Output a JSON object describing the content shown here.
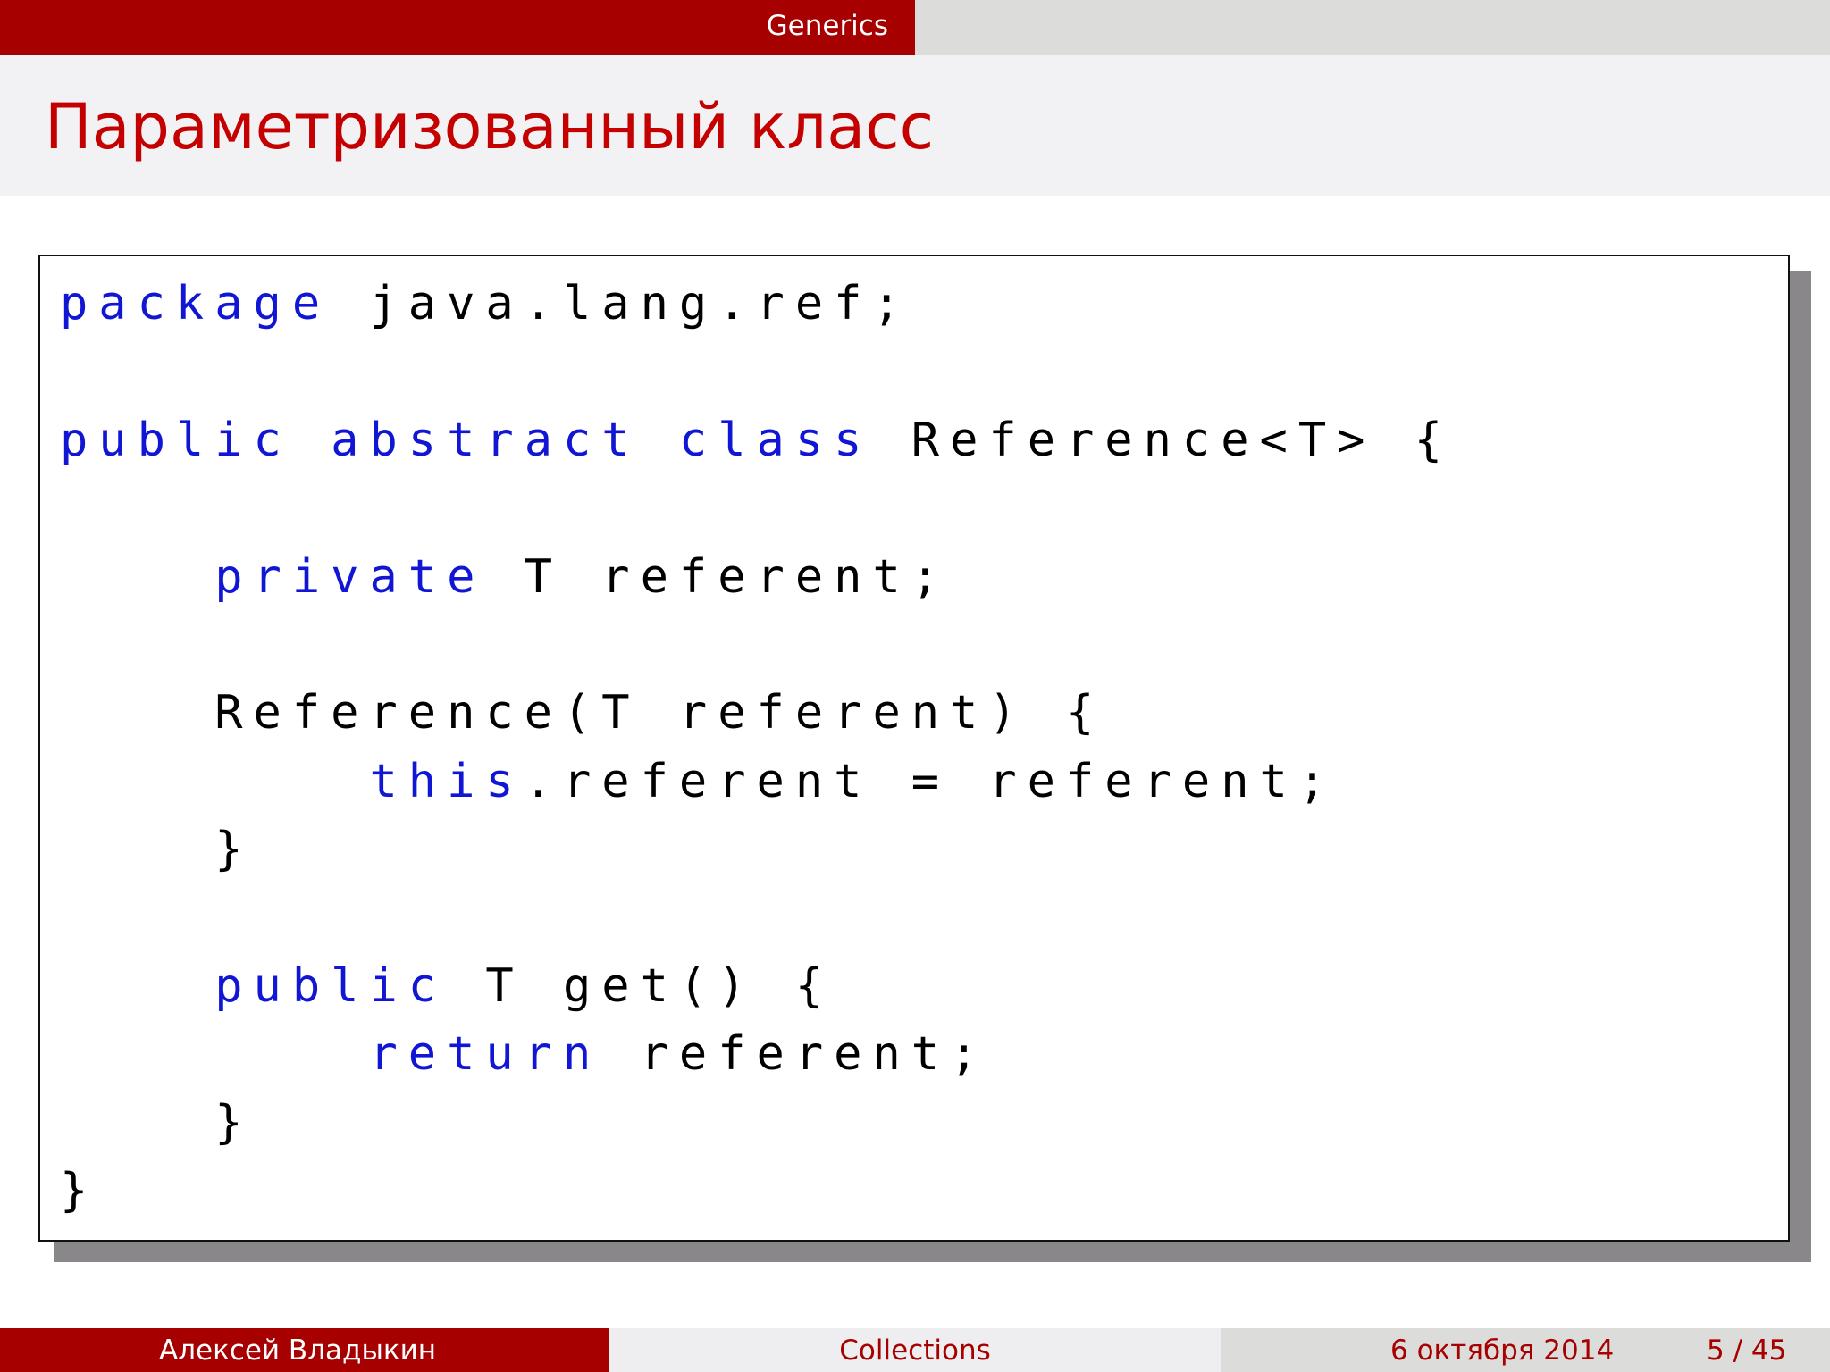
{
  "header": {
    "section": "Generics"
  },
  "frame": {
    "title": "Параметризованный класс"
  },
  "code": {
    "lines": [
      [
        {
          "t": "package",
          "kw": true
        },
        {
          "t": " java.lang.ref;"
        }
      ],
      [],
      [
        {
          "t": "public",
          "kw": true
        },
        {
          "t": " "
        },
        {
          "t": "abstract",
          "kw": true
        },
        {
          "t": " "
        },
        {
          "t": "class",
          "kw": true
        },
        {
          "t": " Reference<T> {"
        }
      ],
      [],
      [
        {
          "t": "    "
        },
        {
          "t": "private",
          "kw": true
        },
        {
          "t": " T referent;"
        }
      ],
      [],
      [
        {
          "t": "    Reference(T referent) {"
        }
      ],
      [
        {
          "t": "        "
        },
        {
          "t": "this",
          "kw": true
        },
        {
          "t": ".referent = referent;"
        }
      ],
      [
        {
          "t": "    }"
        }
      ],
      [],
      [
        {
          "t": "    "
        },
        {
          "t": "public",
          "kw": true
        },
        {
          "t": " T get() {"
        }
      ],
      [
        {
          "t": "        "
        },
        {
          "t": "return",
          "kw": true
        },
        {
          "t": " referent;"
        }
      ],
      [
        {
          "t": "    }"
        }
      ],
      [
        {
          "t": "}"
        }
      ]
    ]
  },
  "footer": {
    "author": "Алексей Владыкин",
    "topic": "Collections",
    "date": "6 октября 2014",
    "page": "5 / 45"
  },
  "colors": {
    "theme_red": "#a60000",
    "title_red": "#c40000",
    "keyword_blue": "#1016d3"
  }
}
